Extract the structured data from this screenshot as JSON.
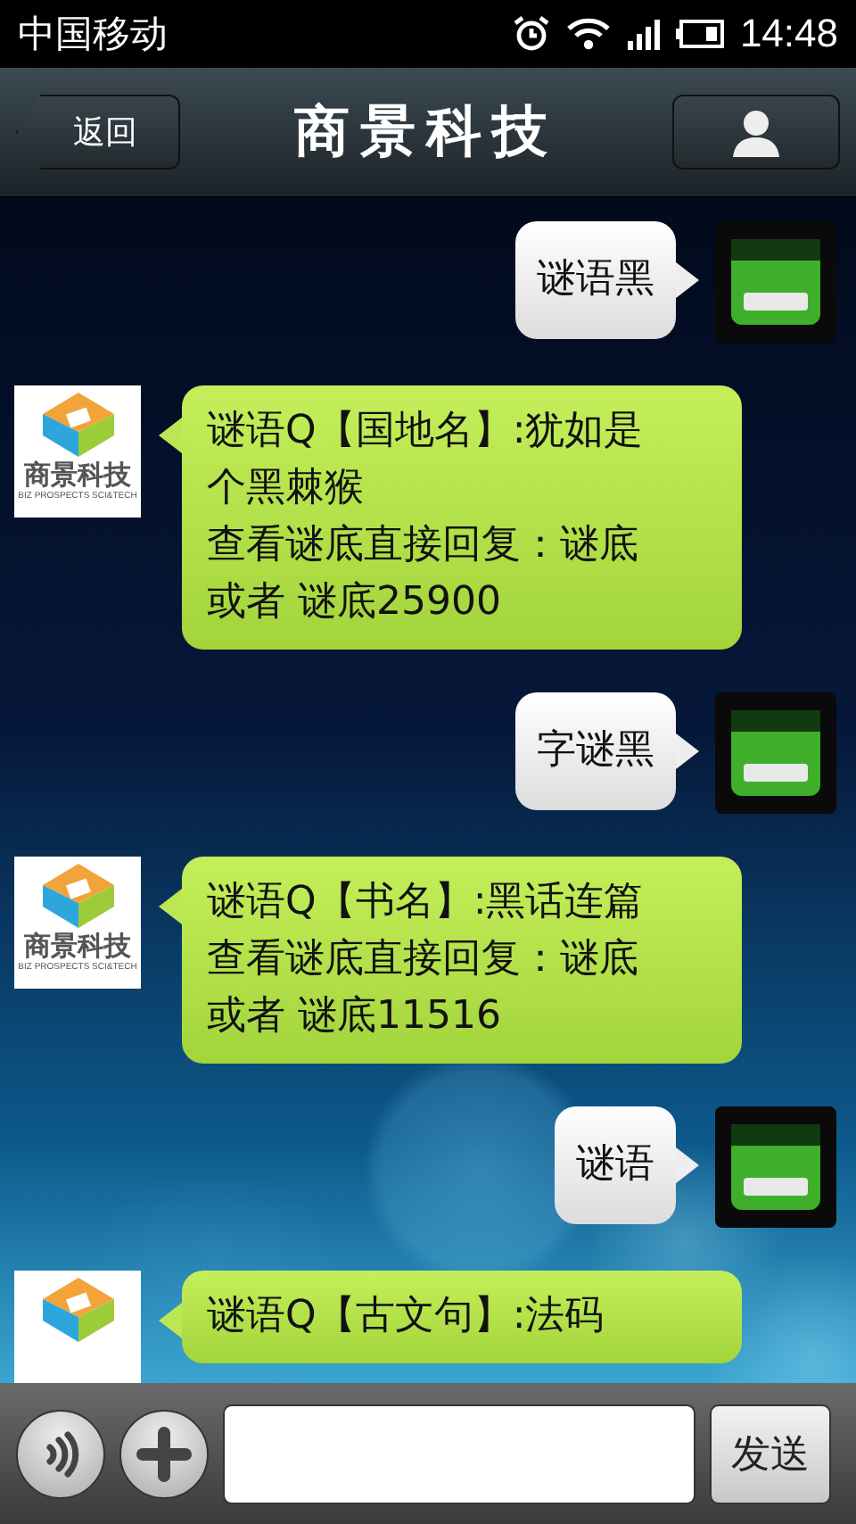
{
  "status_bar": {
    "carrier": "中国移动",
    "time": "14:48"
  },
  "header": {
    "back": "返回",
    "title": "商景科技"
  },
  "messages": [
    {
      "kind": "sent",
      "paragraphs": [
        "谜语黑"
      ]
    },
    {
      "kind": "received",
      "paragraphs": [
        "谜语Q【国地名】:犹如是个黑棘猴",
        "查看谜底直接回复：谜底或者 谜底25900"
      ],
      "logo_name": "商景科技",
      "logo_subtitle": "BIZ PROSPECTS SCI&TECH"
    },
    {
      "kind": "sent",
      "paragraphs": [
        "字谜黑"
      ]
    },
    {
      "kind": "received",
      "paragraphs": [
        "谜语Q【书名】:黑话连篇查看谜底直接回复：谜底或者 谜底11516"
      ],
      "logo_name": "商景科技",
      "logo_subtitle": "BIZ PROSPECTS SCI&TECH"
    },
    {
      "kind": "sent",
      "paragraphs": [
        "谜语"
      ]
    },
    {
      "kind": "received",
      "paragraphs": [
        "谜语Q【古文句】:法码"
      ]
    }
  ],
  "input_bar": {
    "send": "发送"
  }
}
